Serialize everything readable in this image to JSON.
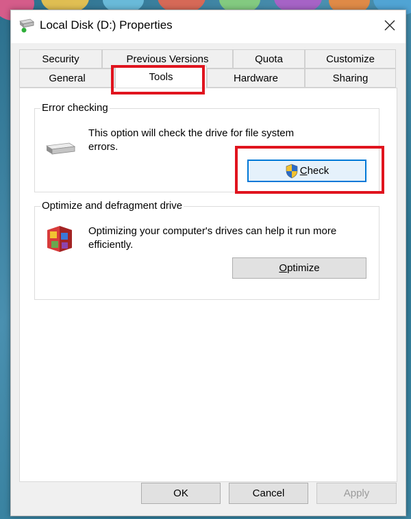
{
  "window": {
    "title": "Local Disk (D:) Properties"
  },
  "tabs": {
    "row1": [
      "Security",
      "Previous Versions",
      "Quota",
      "Customize"
    ],
    "row2": [
      "General",
      "Tools",
      "Hardware",
      "Sharing"
    ],
    "active": "Tools"
  },
  "error_checking": {
    "label": "Error checking",
    "description": "This option will check the drive for file system errors.",
    "button_mnemonic": "C",
    "button_rest": "heck"
  },
  "optimize": {
    "label": "Optimize and defragment drive",
    "description": "Optimizing your computer's drives can help it run more efficiently.",
    "button_mnemonic": "O",
    "button_rest": "ptimize"
  },
  "footer": {
    "ok": "OK",
    "cancel": "Cancel",
    "apply": "Apply"
  },
  "colors": {
    "highlight": "#e0141e",
    "accent": "#0078d7"
  }
}
